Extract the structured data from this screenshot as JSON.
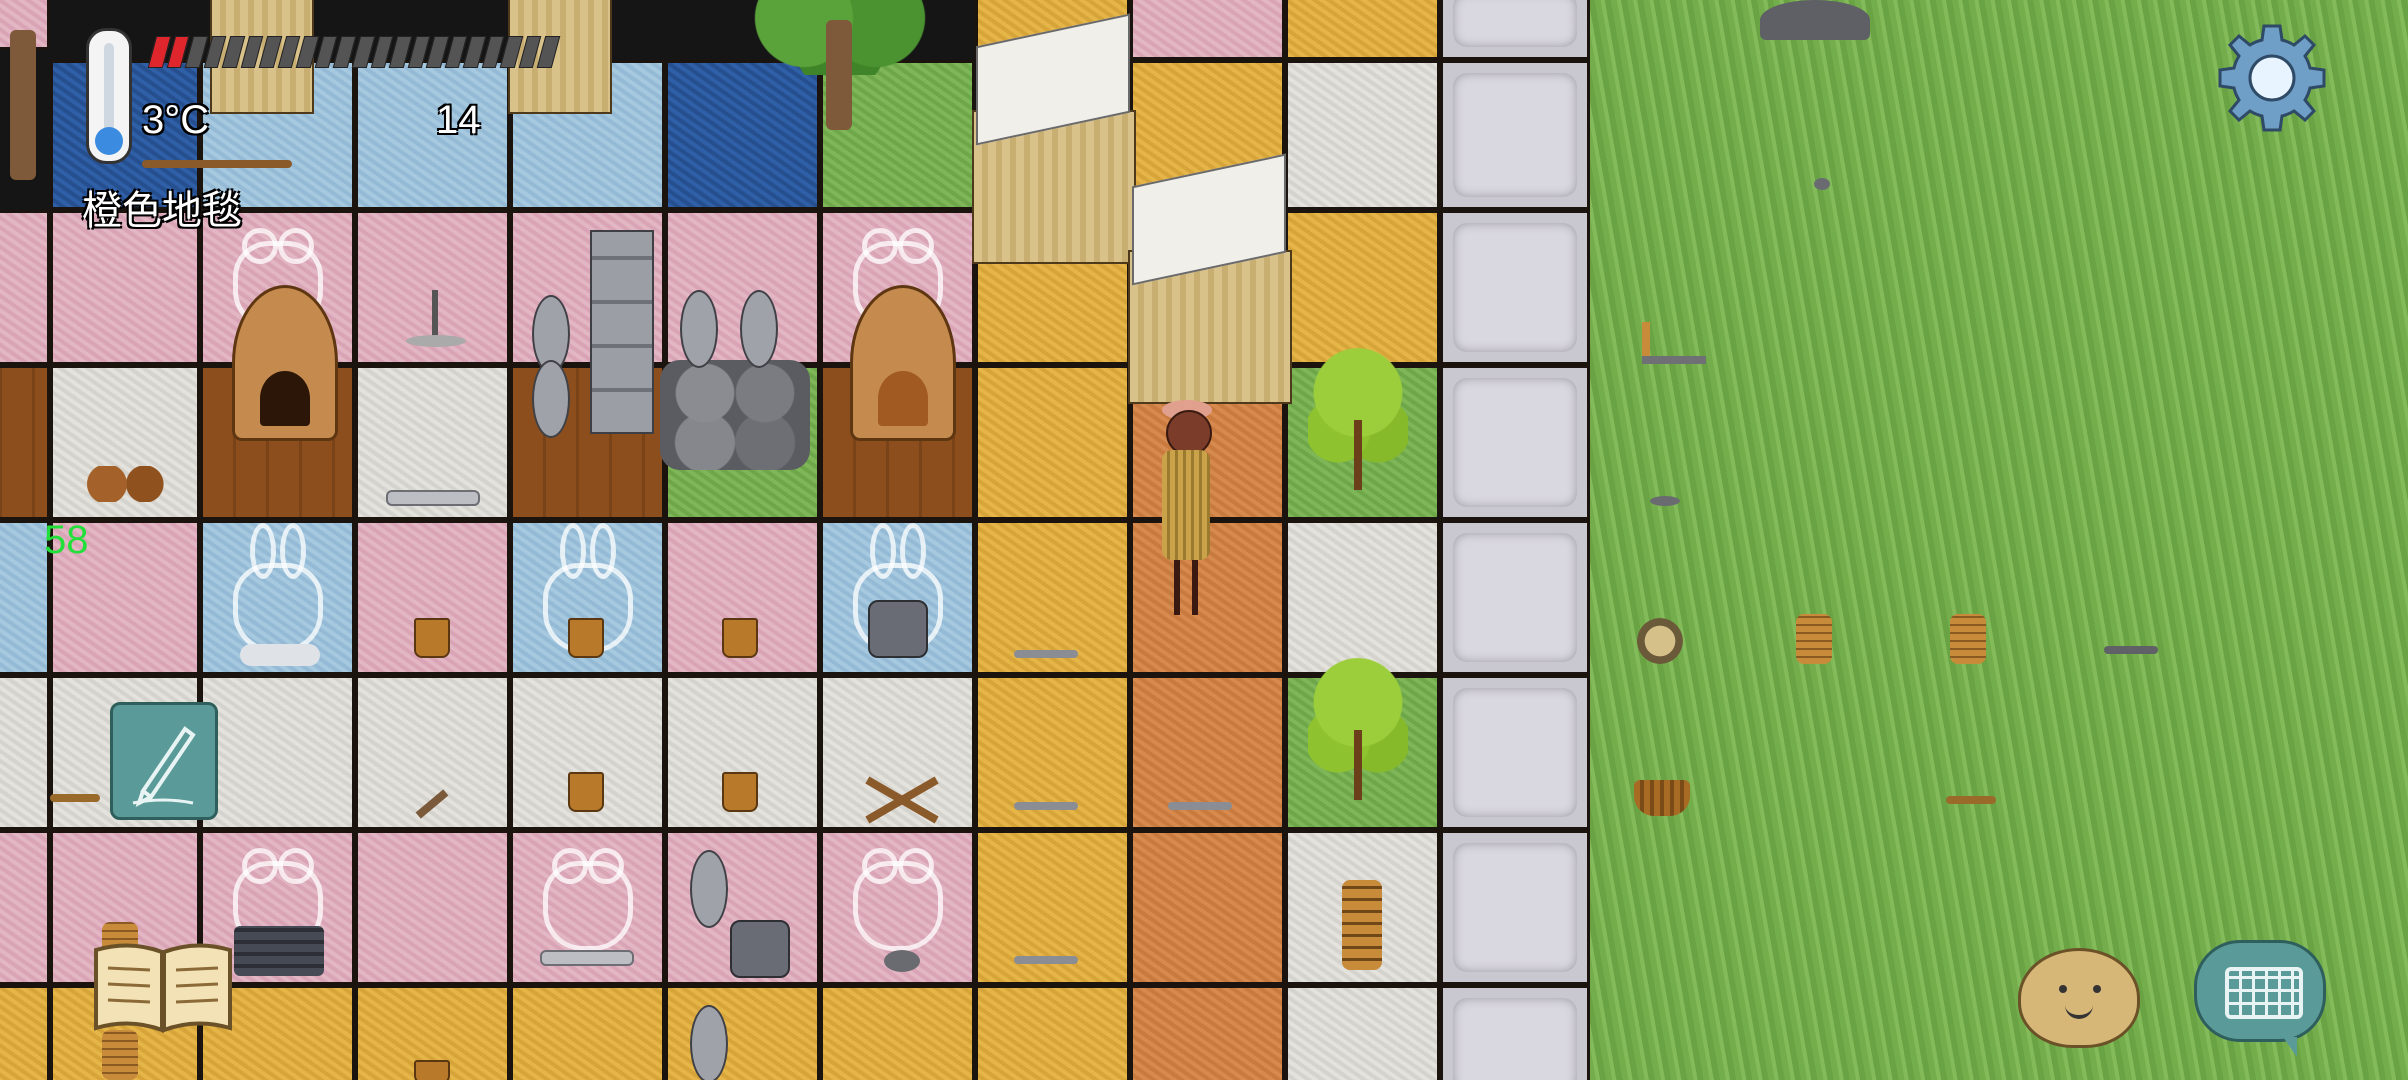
{
  "hud": {
    "temperature": "3°C",
    "count": "14",
    "held_item": "橙色地毯",
    "fps": "58",
    "health_segments_total": 22,
    "health_segments_filled": 2
  },
  "icons": {
    "settings": "gear-icon",
    "note": "pencil-icon",
    "recipes": "book-icon",
    "emote": "smiley-face-icon",
    "chat": "keyboard-icon",
    "temperature": "thermometer-icon"
  },
  "colors": {
    "health": "#e0262d",
    "fps": "#22e03a",
    "hud_button": "#5a9a98"
  }
}
